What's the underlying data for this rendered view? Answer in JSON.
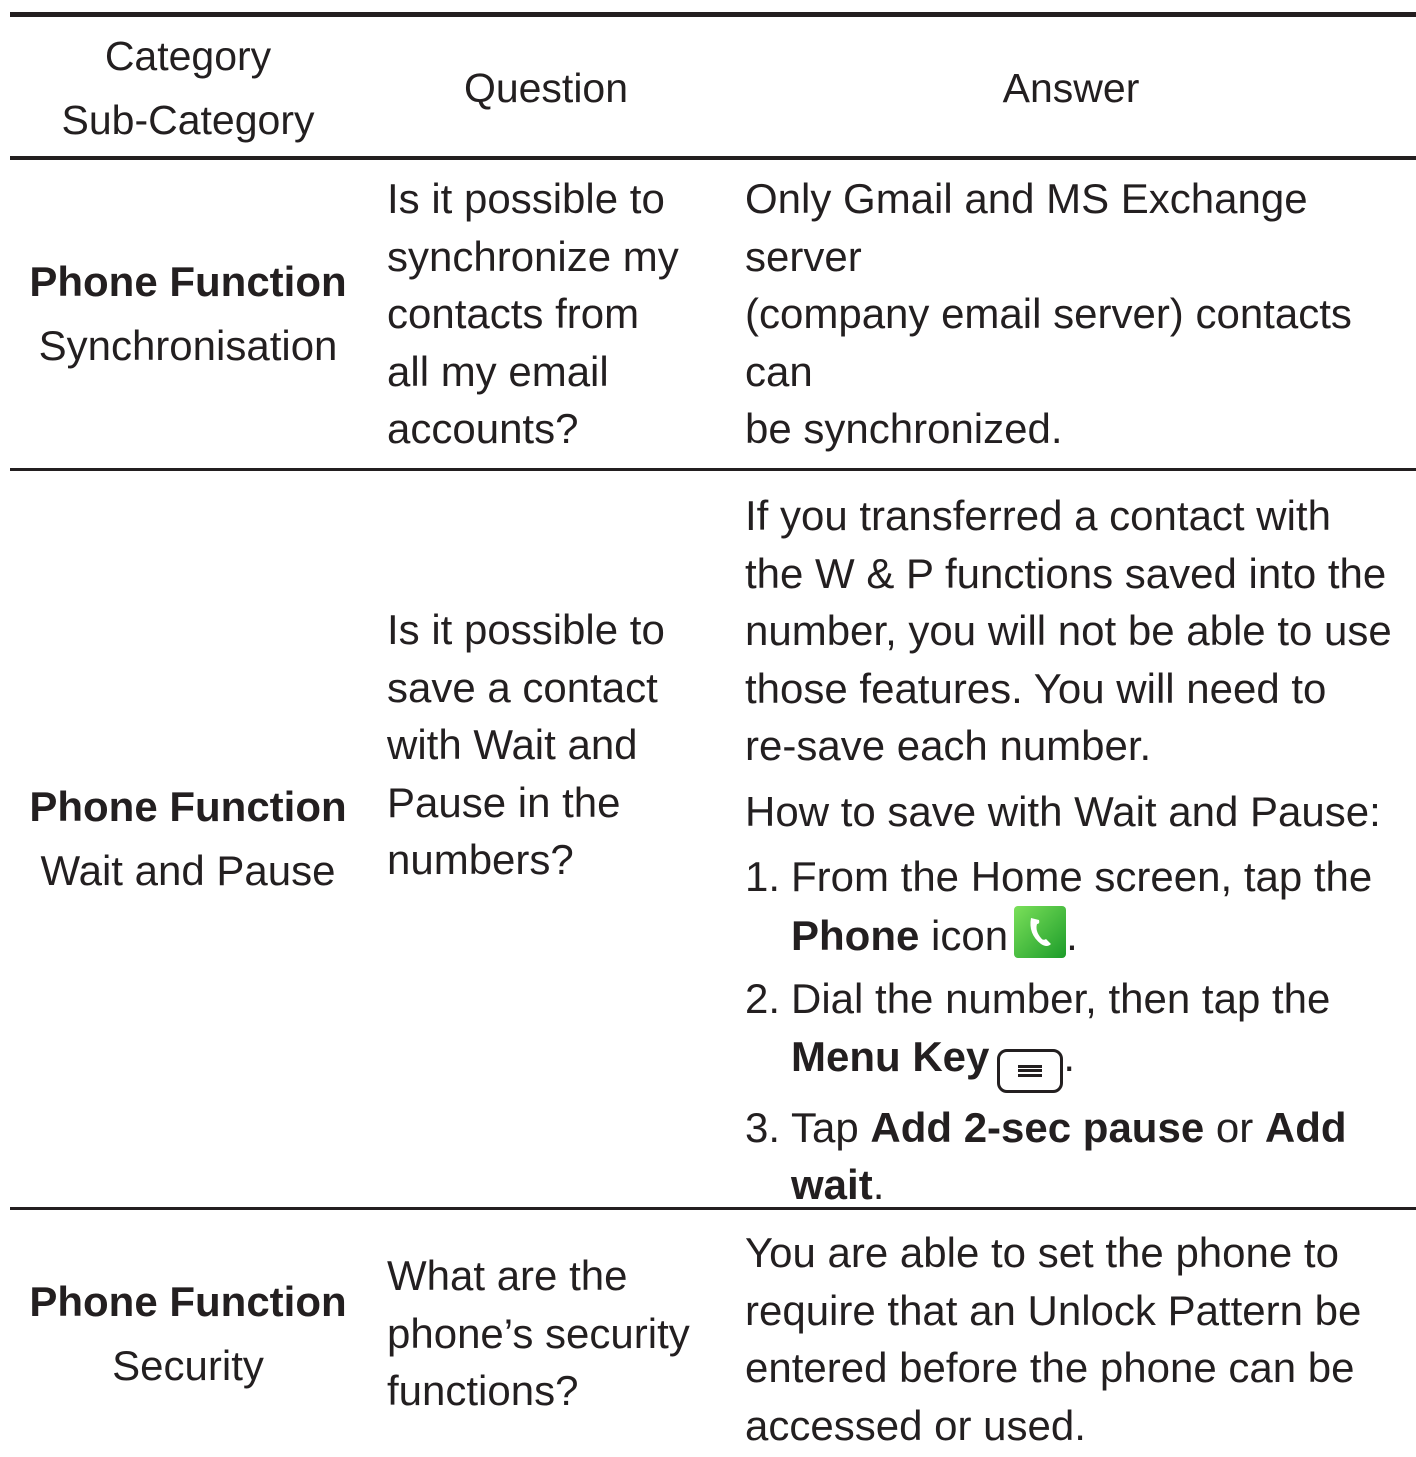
{
  "header": {
    "category": "Category",
    "subcategory": "Sub-Category",
    "question": "Question",
    "answer": "Answer"
  },
  "rows": [
    {
      "category": "Phone Function",
      "subcategory": "Synchronisation",
      "question": [
        "Is it possible to",
        "synchronize my",
        "contacts from",
        "all my email",
        "accounts?"
      ],
      "answer": [
        "Only Gmail and MS Exchange server",
        "(company email server) contacts can",
        "be synchronized."
      ]
    },
    {
      "category": "Phone Function",
      "subcategory": "Wait and Pause",
      "question": [
        "Is it possible to",
        "save a contact",
        "with Wait and",
        "Pause in the",
        "numbers?"
      ],
      "answer_intro": [
        "If you transferred a contact with",
        "the W & P functions saved into the",
        "number, you will not be able to use",
        "those features. You will need to",
        "re-save each number."
      ],
      "answer_howto": "How to save with Wait and Pause:",
      "steps": [
        {
          "num": "1.",
          "line1": "From the Home screen, tap the",
          "bold": "Phone",
          "tail": " icon",
          "end": "."
        },
        {
          "num": "2.",
          "line1": "Dial the number, then tap the",
          "bold": "Menu Key",
          "end": "."
        },
        {
          "num": "3.",
          "pre": "Tap ",
          "bold1": "Add 2-sec pause",
          "mid": " or ",
          "bold2": "Add",
          "bold3": "wait",
          "end": "."
        }
      ],
      "icons": {
        "phone": "phone-app-icon",
        "menu": "menu-key-icon",
        "phone_color": "#2fb53a"
      }
    },
    {
      "category": "Phone Function",
      "subcategory": "Security",
      "question": [
        "What are the",
        "phone’s security",
        "functions?"
      ],
      "answer": [
        "You are able to set the phone to",
        "require that an Unlock Pattern be",
        "entered before the phone can be",
        "accessed or used."
      ]
    }
  ]
}
